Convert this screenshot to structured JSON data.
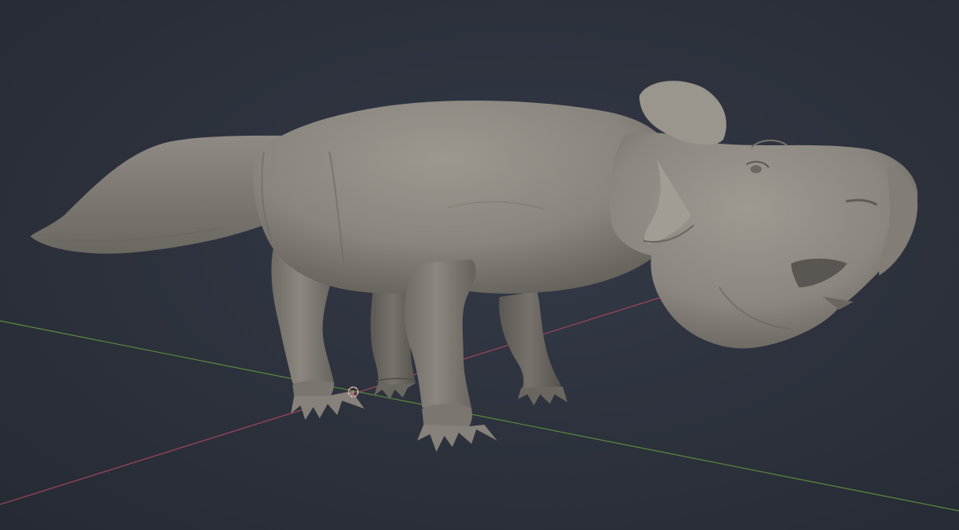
{
  "viewport": {
    "kind": "3d-viewport",
    "background_color": "#2d323d",
    "x_axis_color": "#9a4557",
    "y_axis_color": "#5a8a3c",
    "model_color": "#8a857e"
  },
  "scene": {
    "model": {
      "name": "dinosaur-sculpt",
      "icon": "ceratopsian-model"
    },
    "origin_marker": {
      "icon": "object-origin-icon",
      "color": "#d07a7a"
    }
  }
}
